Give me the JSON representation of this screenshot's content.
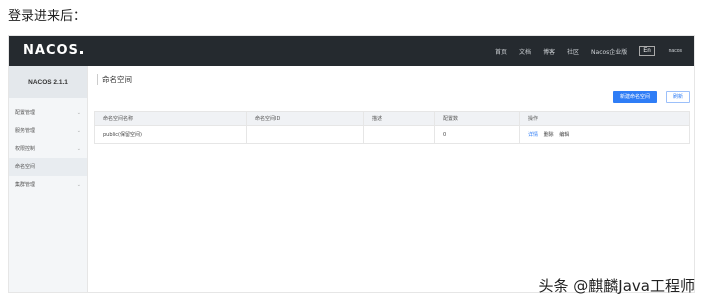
{
  "caption": "登录进来后：",
  "header": {
    "logo": "NACOS",
    "nav": [
      "首页",
      "文档",
      "博客",
      "社区",
      "Nacos企业版"
    ],
    "language": "En",
    "user": "nacos"
  },
  "sidebar": {
    "version": "NACOS 2.1.1",
    "items": [
      {
        "label": "配置管理",
        "chevron": "⌄"
      },
      {
        "label": "服务管理",
        "chevron": "⌄"
      },
      {
        "label": "权限控制",
        "chevron": "⌄"
      },
      {
        "label": "命名空间",
        "chevron": ""
      },
      {
        "label": "集群管理",
        "chevron": "⌄"
      }
    ]
  },
  "main": {
    "title": "命名空间",
    "create_button": "新建命名空间",
    "refresh_button": "刷新",
    "table": {
      "columns": [
        "命名空间名称",
        "命名空间ID",
        "描述",
        "配置数",
        "操作"
      ],
      "rows": [
        {
          "name": "public(保留空间)",
          "id": "",
          "desc": "",
          "count": "0",
          "ops": [
            "详情",
            "删除",
            "编辑"
          ]
        }
      ]
    }
  },
  "watermark": "头条 @麒麟Java工程师"
}
